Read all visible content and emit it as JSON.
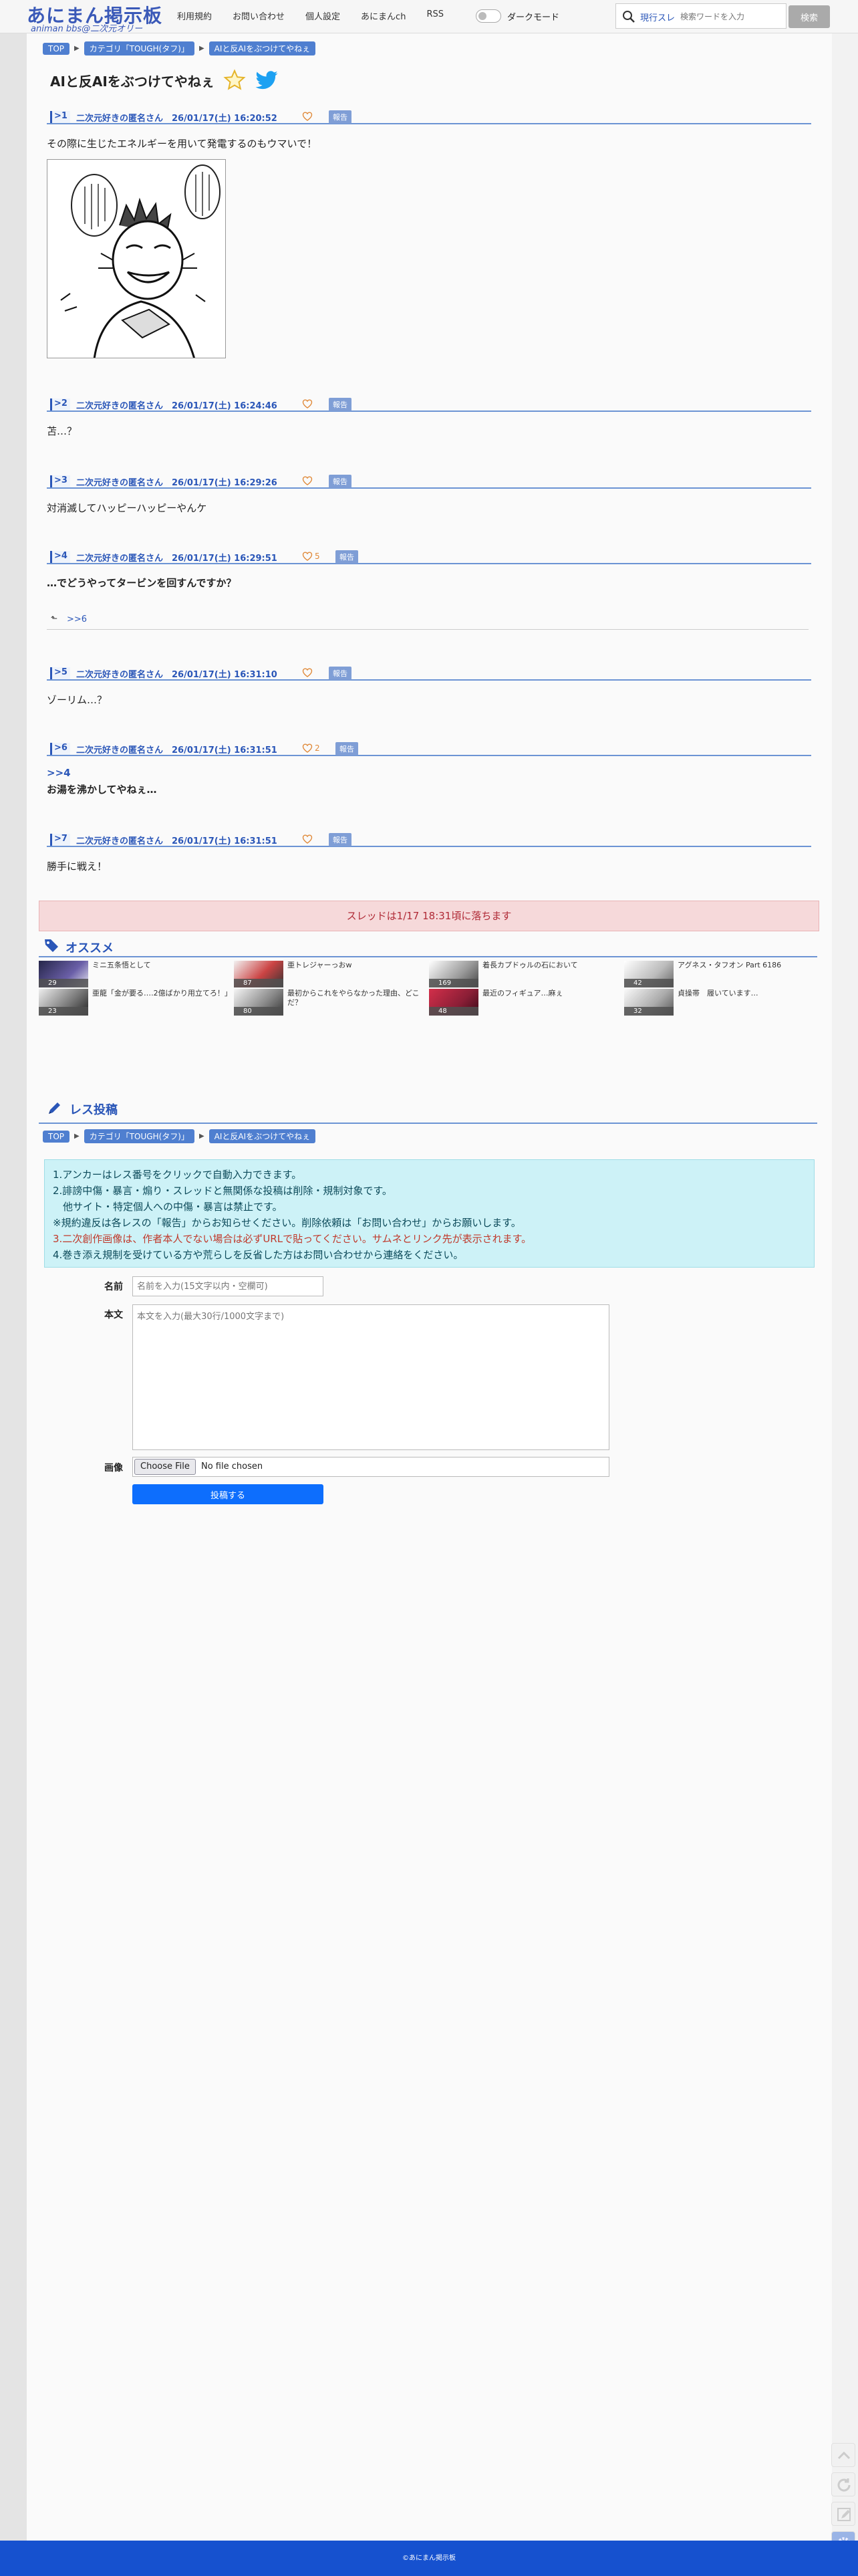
{
  "site": {
    "logo": "あにまん掲示板",
    "logo_sub": "animan bbs@二次元オリー"
  },
  "nav": [
    "利用規約",
    "お問い合わせ",
    "個人設定",
    "あにまんch",
    "RSS"
  ],
  "dark_mode_label": "ダークモード",
  "search": {
    "scope": "現行スレ",
    "placeholder": "検索ワードを入力",
    "button": "検索"
  },
  "breadcrumbs": [
    "TOP",
    "カテゴリ「TOUGH(タフ)」",
    "AIと反AIをぶつけてやねぇ"
  ],
  "thread_title": "AIと反AIをぶつけてやねぇ",
  "report_label": "報告",
  "posts": [
    {
      "num": ">1",
      "meta": "二次元好きの匿名さん　26/01/17(土) 16:20:52",
      "likes": "",
      "body": "その際に生じたエネルギーを用いて発電するのもウマいで！"
    },
    {
      "num": ">2",
      "meta": "二次元好きの匿名さん　26/01/17(土) 16:24:46",
      "likes": "",
      "body": "苫…？"
    },
    {
      "num": ">3",
      "meta": "二次元好きの匿名さん　26/01/17(土) 16:29:26",
      "likes": "",
      "body": "対消滅してハッピーハッピーやんケ"
    },
    {
      "num": ">4",
      "meta": "二次元好きの匿名さん　26/01/17(土) 16:29:51",
      "likes": "5",
      "body": "…でどうやってタービンを回すんですか？",
      "reply": ">>6"
    },
    {
      "num": ">5",
      "meta": "二次元好きの匿名さん　26/01/17(土) 16:31:10",
      "likes": "",
      "body": "ゾーリム…？"
    },
    {
      "num": ">6",
      "meta": "二次元好きの匿名さん　26/01/17(土) 16:31:51",
      "likes": "2",
      "anchor": ">>4",
      "body": "お湯を沸かしてやねぇ…"
    },
    {
      "num": ">7",
      "meta": "二次元好きの匿名さん　26/01/17(土) 16:31:51",
      "likes": "",
      "body": "勝手に戦え！"
    }
  ],
  "expire_notice": "スレッドは1/17 18:31頃に落ちます",
  "reco_title": "オススメ",
  "reco": [
    {
      "count": "29",
      "title": "ミニ五条悟として"
    },
    {
      "count": "87",
      "title": "亜トレジャーっおw"
    },
    {
      "count": "169",
      "title": "着長カプドゥルの石において"
    },
    {
      "count": "42",
      "title": "アグネス・タフオン Part 6186"
    },
    {
      "count": "23",
      "title": "亜龍「金が要る‥‥2億ばかり用立てろ！」"
    },
    {
      "count": "80",
      "title": "最初からこれをやらなかった理由、どこだ？"
    },
    {
      "count": "48",
      "title": "最近のフィギュア…麻ぇ"
    },
    {
      "count": "32",
      "title": "貞操帯　履いています…"
    }
  ],
  "form": {
    "title": "レス投稿",
    "rules": [
      "1.アンカーはレス番号をクリックで自動入力できます。",
      "2.誹謗中傷・暴言・煽り・スレッドと無関係な投稿は削除・規制対象です。",
      "　他サイト・特定個人への中傷・暴言は禁止です。",
      "※規約違反は各レスの「報告」からお知らせください。削除依頼は「お問い合わせ」からお願いします。",
      "3.二次創作画像は、作者本人でない場合は必ずURLで貼ってください。サムネとリンク先が表示されます。",
      "4.巻き添え規制を受けている方や荒らしを反省した方はお問い合わせから連絡をください。"
    ],
    "name_label": "名前",
    "name_placeholder": "名前を入力(15文字以内・空欄可)",
    "body_label": "本文",
    "body_placeholder": "本文を入力(最大30行/1000文字まで)",
    "image_label": "画像",
    "file_button": "Choose File",
    "file_status": "No file chosen",
    "submit": "投稿する"
  },
  "footer": "©あにまん掲示板",
  "colors": {
    "accent": "#2a56b8",
    "rule_line": "#6c94d4",
    "footer": "#1651cf",
    "like": "#e08a3a"
  }
}
